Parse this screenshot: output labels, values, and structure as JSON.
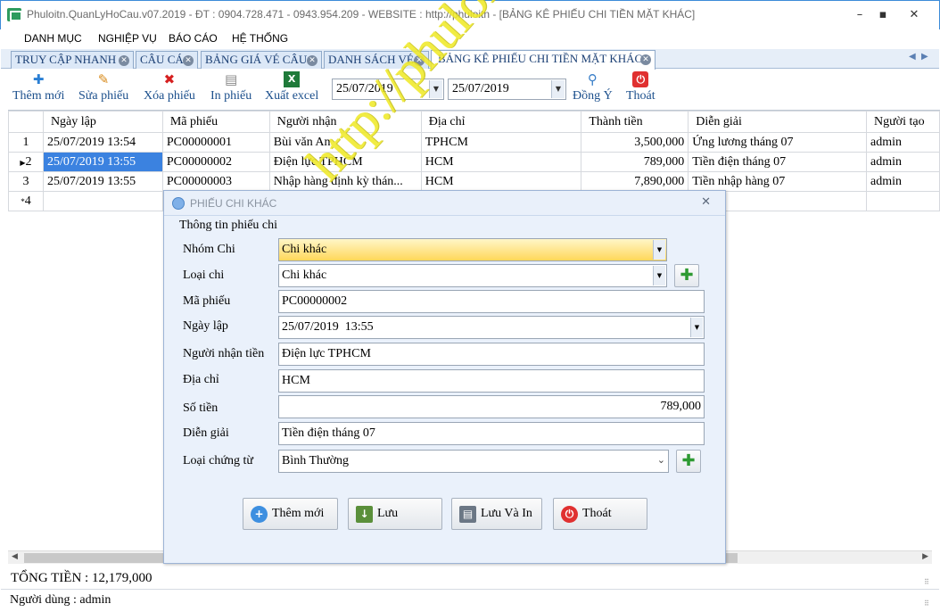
{
  "window": {
    "title": "Phuloitn.QuanLyHoCau.v07.2019 - ĐT : 0904.728.471 - 0943.954.209 - WEBSITE : http://phuloitn - [BẢNG KÊ PHIẾU CHI TIỀN MẶT KHÁC]",
    "min": "–",
    "max": "▪",
    "close": "✕"
  },
  "menu": [
    "DANH MỤC",
    "NGHIỆP VỤ",
    "BÁO CÁO",
    "HỆ THỐNG"
  ],
  "tabs": [
    {
      "label": "TRUY CẬP NHANH"
    },
    {
      "label": "CÂU CÁ"
    },
    {
      "label": "BẢNG GIÁ VÉ CÂU"
    },
    {
      "label": "DANH SÁCH VÉ"
    },
    {
      "label": "BẢNG KÊ PHIẾU CHI TIỀN MẶT KHÁC"
    }
  ],
  "toolbar": {
    "add": "Thêm mới",
    "edit": "Sửa phiếu",
    "delete": "Xóa phiếu",
    "print": "In phiếu",
    "export": "Xuất excel",
    "date_from": "25/07/2019",
    "date_to": "25/07/2019",
    "agree": "Đồng Ý",
    "exit": "Thoát"
  },
  "grid": {
    "columns": [
      "Ngày lập",
      "Mã phiếu",
      "Người nhận",
      "Địa chỉ",
      "Thành tiền",
      "Diễn giải",
      "Người tạo"
    ],
    "rows": [
      {
        "n": "1",
        "date": "25/07/2019 13:54",
        "code": "PC00000001",
        "receiver": "Bùi văn An",
        "addr": "TPHCM",
        "amount": "3,500,000",
        "note": "Ứng lương tháng 07",
        "creator": "admin"
      },
      {
        "n": "2",
        "date": "25/07/2019 13:55",
        "code": "PC00000002",
        "receiver": "Điện lực TPHCM",
        "addr": "HCM",
        "amount": "789,000",
        "note": "Tiền điện tháng 07",
        "creator": "admin"
      },
      {
        "n": "3",
        "date": "25/07/2019 13:55",
        "code": "PC00000003",
        "receiver": "Nhập hàng định kỳ thán...",
        "addr": "HCM",
        "amount": "7,890,000",
        "note": "Tiền nhập hàng 07",
        "creator": "admin"
      }
    ],
    "new_row": "4"
  },
  "footer": {
    "total": "TỔNG TIỀN : 12,179,000",
    "user": "Người dùng : admin"
  },
  "dialog": {
    "title": "PHIẾU CHI KHÁC",
    "group": "Thông tin phiếu chi",
    "labels": {
      "group_expense": "Nhóm Chi",
      "type": "Loại chi",
      "code": "Mã phiếu",
      "date": "Ngày lập",
      "receiver": "Người nhận tiền",
      "address": "Địa chỉ",
      "amount": "Số tiền",
      "note": "Diễn giải",
      "doc_type": "Loại chứng từ"
    },
    "values": {
      "group_expense": "Chi khác",
      "type": "Chi khác",
      "code": "PC00000002",
      "date": "25/07/2019  13:55",
      "receiver": "Điện lực TPHCM",
      "address": "HCM",
      "amount": "789,000",
      "note": "Tiền điện tháng 07",
      "doc_type": "Bình Thường"
    },
    "buttons": {
      "add": "Thêm mới",
      "save": "Lưu",
      "save_print": "Lưu Và In",
      "exit": "Thoát"
    }
  },
  "watermark": "http://phuloitn.com"
}
